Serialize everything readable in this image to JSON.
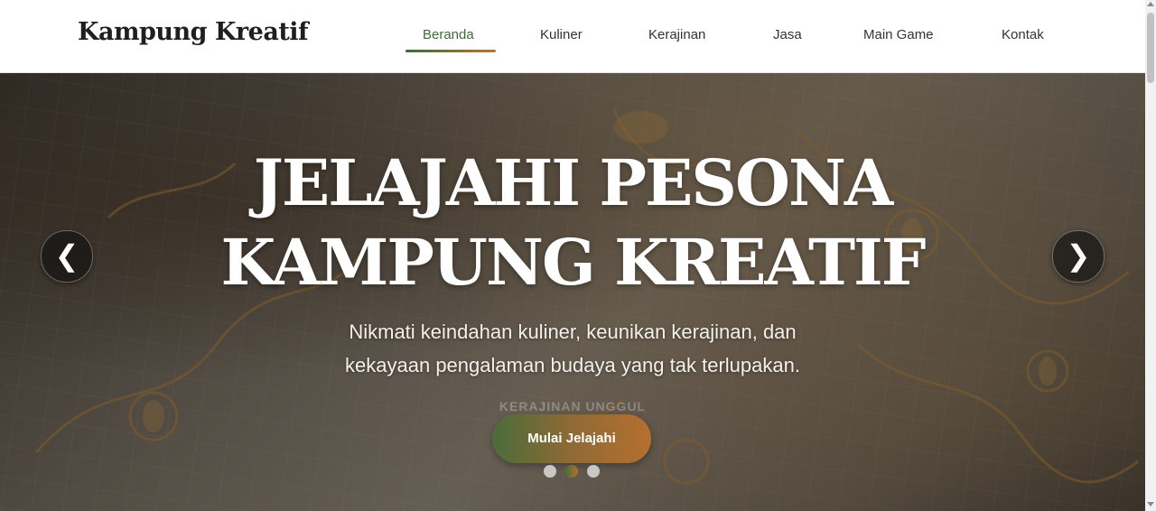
{
  "brand": "Kampung Kreatif",
  "nav": {
    "items": [
      {
        "label": "Beranda",
        "active": true
      },
      {
        "label": "Kuliner",
        "active": false
      },
      {
        "label": "Kerajinan",
        "active": false
      },
      {
        "label": "Jasa",
        "active": false
      },
      {
        "label": "Main Game",
        "active": false
      },
      {
        "label": "Kontak",
        "active": false
      }
    ]
  },
  "hero": {
    "title_line1": "JELAJAHI PESONA",
    "title_line2": "KAMPUNG KREATIF",
    "subtitle_line1": "Nikmati keindahan kuliner, keunikan kerajinan, dan",
    "subtitle_line2": "kekayaan pengalaman budaya yang tak terlupakan.",
    "slide_tag": "KERAJINAN UNGGUL",
    "cta_label": "Mulai Jelajahi",
    "prev_icon": "❮",
    "next_icon": "❯",
    "active_slide": 2,
    "slide_count": 3
  },
  "colors": {
    "accent_green": "#3f6b3a",
    "accent_orange": "#b5702f"
  }
}
